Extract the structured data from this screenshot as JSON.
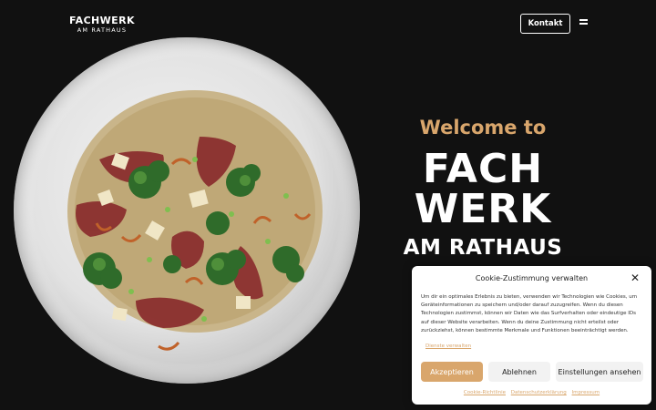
{
  "header": {
    "logo_line1": "FACHWERK",
    "logo_line2": "AM RATHAUS",
    "contact_label": "Kontakt",
    "menu_icon": "hamburger-icon"
  },
  "hero": {
    "welcome": "Welcome to",
    "line1": "FACH",
    "line2": "WERK",
    "line3": "AM RATHAUS"
  },
  "cookie_banner": {
    "title": "Cookie-Zustimmung verwalten",
    "close_icon": "close-icon",
    "body": "Um dir ein optimales Erlebnis zu bieten, verwenden wir Technologien wie Cookies, um Geräteinformationen zu speichern und/oder darauf zuzugreifen. Wenn du diesen Technologien zustimmst, können wir Daten wie das Surfverhalten oder eindeutige IDs auf dieser Website verarbeiten. Wenn du deine Zustimmung nicht erteilst oder zurückziehst, können bestimmte Merkmale und Funktionen beeinträchtigt werden.",
    "manage_services": "Dienste verwalten",
    "accept": "Akzeptieren",
    "deny": "Ablehnen",
    "settings": "Einstellungen ansehen",
    "links": [
      "Cookie-Richtlinie",
      "Datenschutzerklärung",
      "Impressum"
    ]
  },
  "colors": {
    "background": "#111111",
    "accent": "#d9a66c"
  }
}
